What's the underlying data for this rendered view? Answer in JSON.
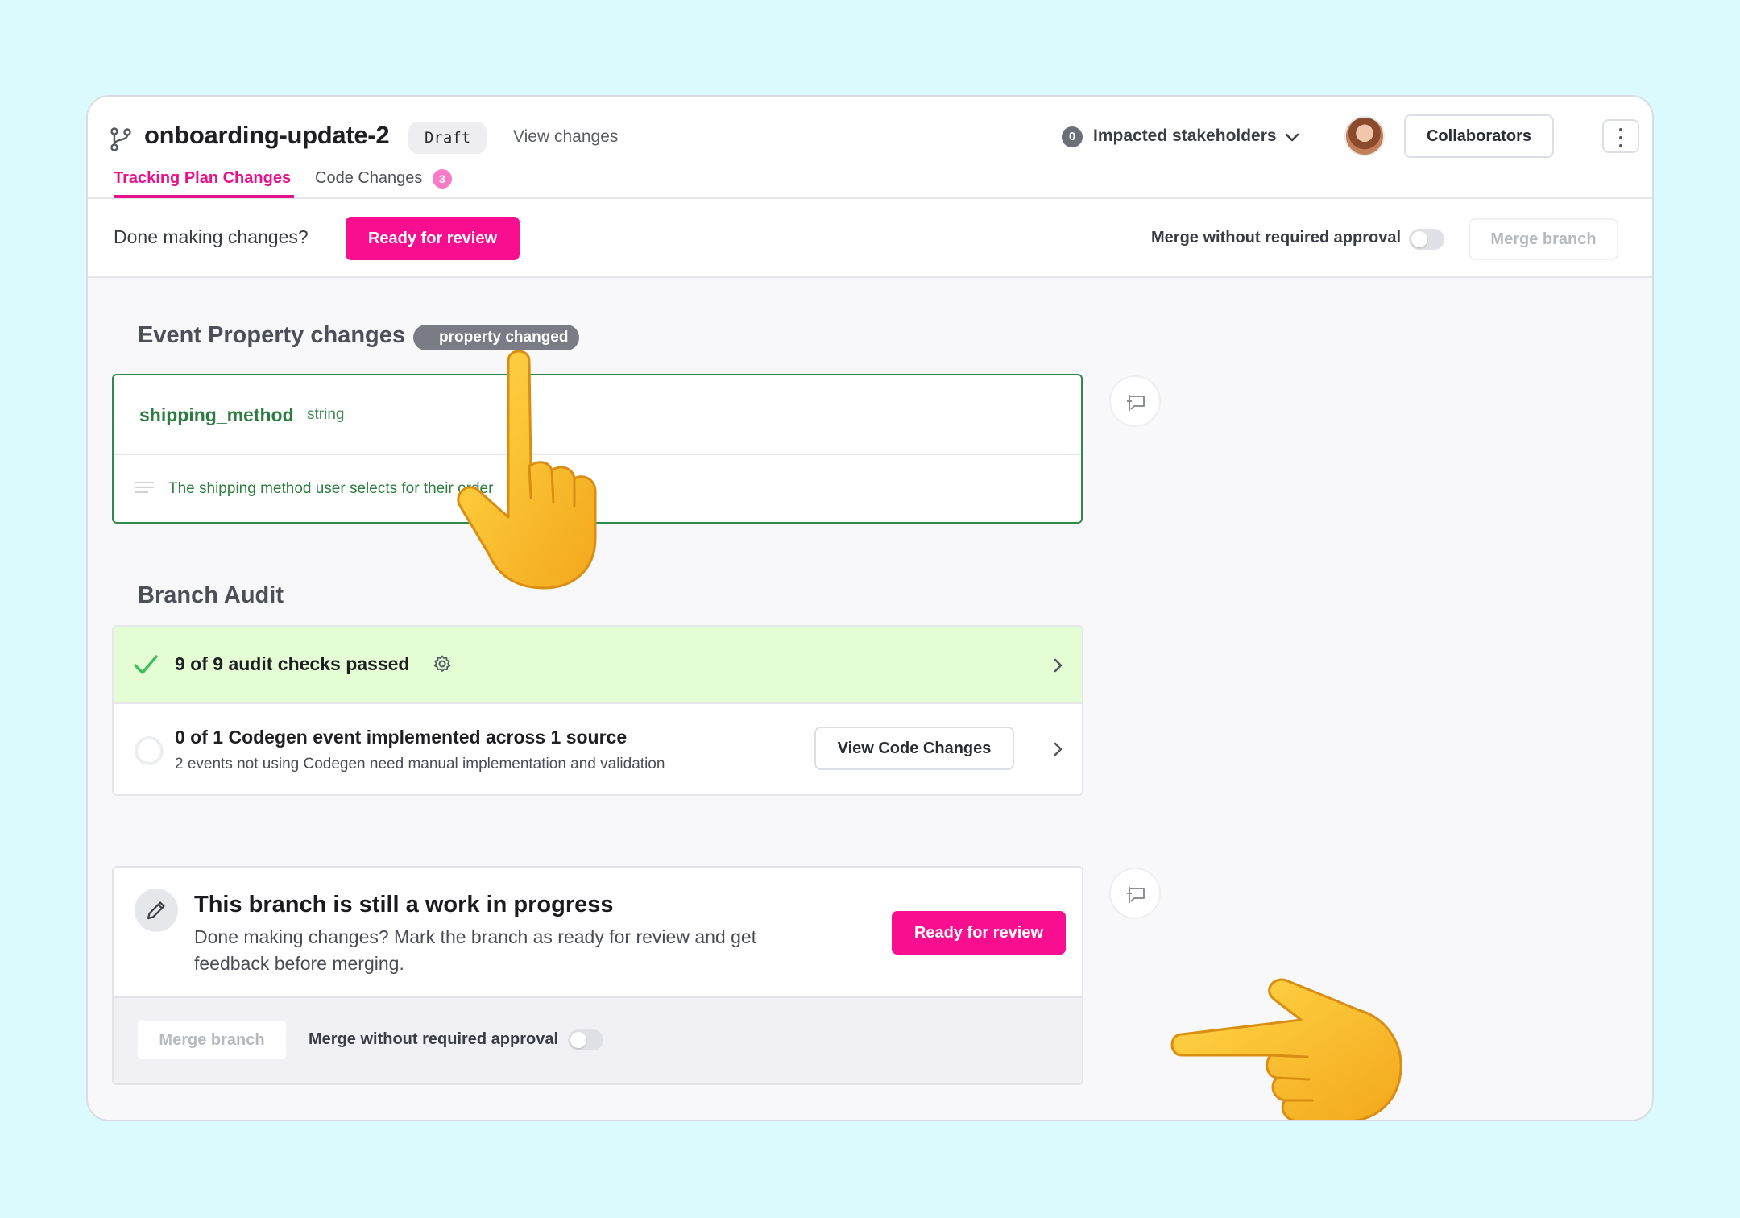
{
  "header": {
    "branch_name": "onboarding-update-2",
    "status_badge": "Draft",
    "view_changes": "View changes",
    "impacted_count": "0",
    "impacted_label": "Impacted stakeholders",
    "collaborators_label": "Collaborators"
  },
  "tabs": [
    {
      "label": "Tracking Plan Changes",
      "active": true
    },
    {
      "label": "Code Changes",
      "badge": "3",
      "active": false
    }
  ],
  "toolbar": {
    "done_label": "Done making changes?",
    "ready_label": "Ready for review",
    "merge_approval_label": "Merge without required approval",
    "merge_approval_on": false,
    "merge_label": "Merge branch"
  },
  "event_property": {
    "title": "Event Property changes",
    "badge": "property changed",
    "name": "shipping_method",
    "type": "string",
    "description": "The shipping method user selects for their order"
  },
  "audit": {
    "title": "Branch Audit",
    "passed_label": "9 of 9 audit checks passed",
    "codegen_title": "0 of 1 Codegen event implemented across 1 source",
    "codegen_subtitle": "2 events not using Codegen need manual implementation and validation",
    "view_code_label": "View Code Changes"
  },
  "wip": {
    "title": "This branch is still a work in progress",
    "description": "Done making changes? Mark the branch as ready for review and get feedback before merging.",
    "ready_label": "Ready for review",
    "merge_label": "Merge branch",
    "merge_approval_label": "Merge without required approval",
    "merge_approval_on": false
  },
  "colors": {
    "accent": "#f90e8f",
    "tab_active": "#e5128a",
    "success_bg": "#e4fdd4",
    "property_green": "#2d7d42",
    "background": "#dbfafd"
  },
  "icons": [
    "branch-icon",
    "chevron-down-icon",
    "more-vertical-icon",
    "comment-icon",
    "check-icon",
    "gear-icon",
    "chevron-right-icon",
    "pencil-icon",
    "description-lines-icon",
    "pointing-hand-icon"
  ]
}
